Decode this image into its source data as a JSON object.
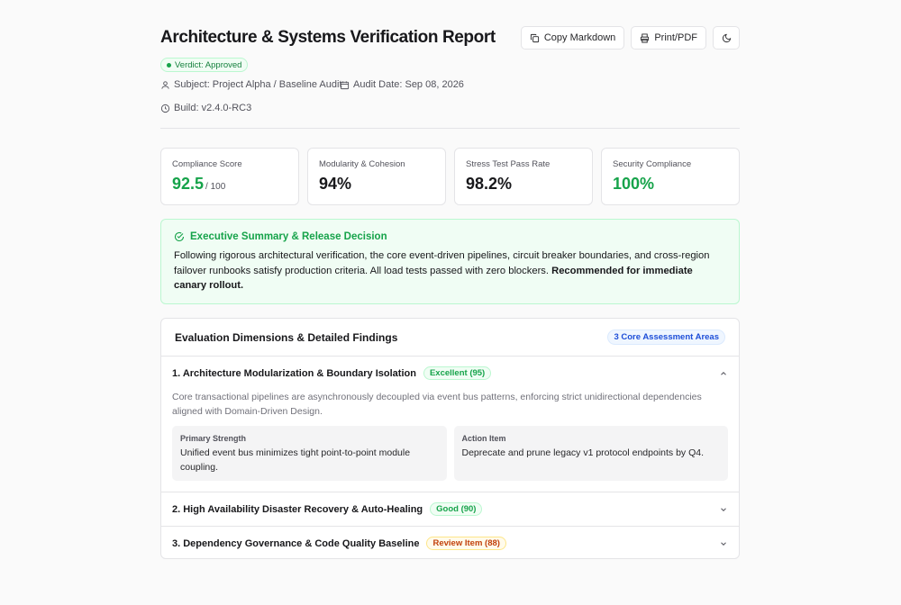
{
  "header": {
    "title": "Architecture & Systems Verification Report",
    "copy_label": "Copy Markdown",
    "print_label": "Print/PDF",
    "verdict": "Verdict: Approved",
    "subject": "Subject: Project Alpha / Baseline Audit",
    "audit_date": "Audit Date: Sep 08, 2026",
    "build": "Build: v2.4.0-RC3"
  },
  "metrics": [
    {
      "label": "Compliance Score",
      "value": "92.5",
      "suffix": "/ 100",
      "color": "#16a34a"
    },
    {
      "label": "Modularity & Cohesion",
      "value": "94%"
    },
    {
      "label": "Stress Test Pass Rate",
      "value": "98.2%"
    },
    {
      "label": "Security Compliance",
      "value": "100%",
      "color": "#16a34a"
    }
  ],
  "summary": {
    "title": "Executive Summary & Release Decision",
    "text": "Following rigorous architectural verification, the core event-driven pipelines, circuit breaker boundaries, and cross-region failover runbooks satisfy production criteria. All load tests passed with zero blockers. ",
    "emphasis": "Recommended for immediate canary rollout."
  },
  "findings": {
    "title": "Evaluation Dimensions & Detailed Findings",
    "badge": "3 Core Assessment Areas",
    "items": [
      {
        "title": "1. Architecture Modularization & Boundary Isolation",
        "score": "Excellent (95)",
        "expanded": true,
        "description": "Core transactional pipelines are asynchronously decoupled via event bus patterns, enforcing strict unidirectional dependencies aligned with Domain-Driven Design.",
        "strength_label": "Primary Strength",
        "strength_text": "Unified event bus minimizes tight point-to-point module coupling.",
        "action_label": "Action Item",
        "action_text": "Deprecate and prune legacy v1 protocol endpoints by Q4."
      },
      {
        "title": "2. High Availability Disaster Recovery & Auto-Healing",
        "score": "Good (90)",
        "expanded": false
      },
      {
        "title": "3. Dependency Governance & Code Quality Baseline",
        "score": "Review Item (88)",
        "expanded": false
      }
    ]
  },
  "colors": {
    "accent_green": "#16a34a",
    "accent_blue": "#1d4ed8",
    "accent_amber": "#c2410c"
  }
}
